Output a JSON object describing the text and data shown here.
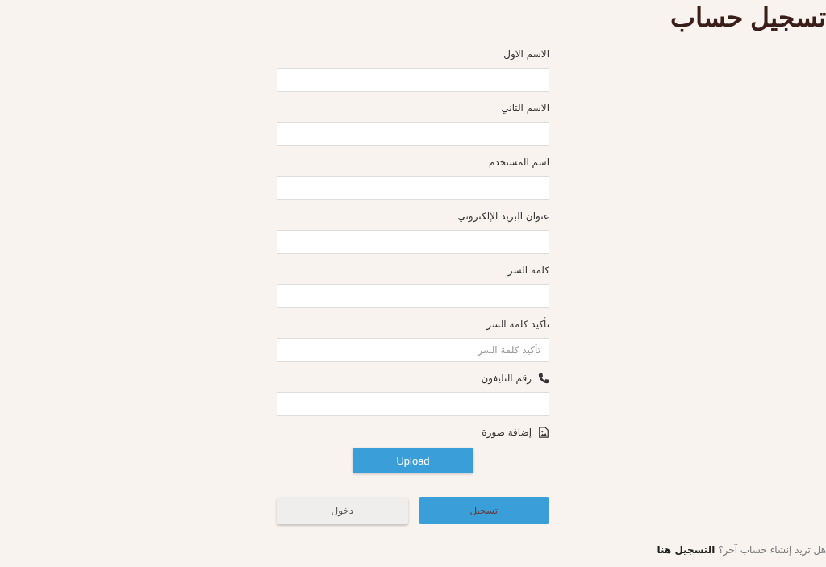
{
  "title": "تسجيل حساب",
  "fields": [
    {
      "label": "الاسم الاول",
      "kind": "text"
    },
    {
      "label": "الاسم الثاني",
      "kind": "text"
    },
    {
      "label": "اسم المستخدم",
      "kind": "text"
    },
    {
      "label": "عنوان البريد الإلكتروني",
      "kind": "text"
    },
    {
      "label": "كلمة السر",
      "kind": "text"
    },
    {
      "label": "تأكيد كلمة السر",
      "kind": "text",
      "placeholder": "تأكيد كلمة السر"
    },
    {
      "label": "رقم التليفون",
      "kind": "phone"
    }
  ],
  "upload": {
    "label": "إضافة صورة",
    "button": "Upload"
  },
  "buttons": [
    {
      "label": "تسجيل",
      "kind": "primary"
    },
    {
      "label": "دخول",
      "kind": "secondary"
    }
  ],
  "footer": {
    "text": "هل تريد إنشاء حساب آخر؟",
    "link": "التسجيل هنا"
  }
}
